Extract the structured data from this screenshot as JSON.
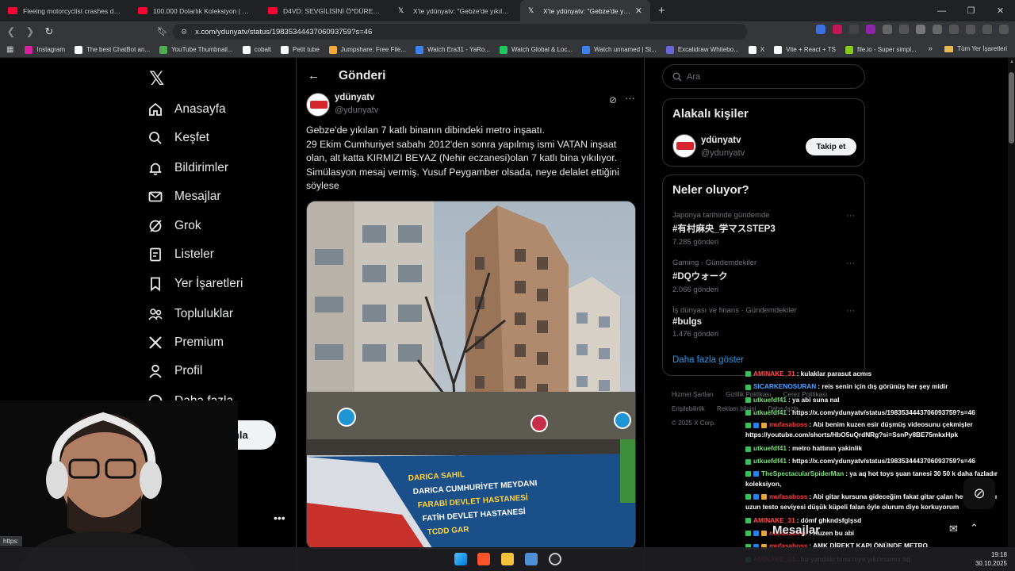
{
  "browser": {
    "tabs": [
      {
        "title": "Fleeing motorcyclist crashes during h",
        "icon_color": "#ff0033"
      },
      {
        "title": "100.000 Dolarlık Koleksiyon | Oyunc",
        "icon_color": "#ff0033"
      },
      {
        "title": "D4VD: SEVGİLİSİNİ Ö*DÜREN ŞARKI",
        "icon_color": "#ff0033"
      },
      {
        "title": "X'te ydünyatv: \"Gebze'de yıkılan 7 kat",
        "icon_color": "#ffffff"
      },
      {
        "title": "X'te ydünyatv: \"Gebze'de yıkılan",
        "icon_color": "#ffffff"
      }
    ],
    "url": "x.com/ydunyatv/status/1983534443706093759?s=46",
    "bookmarks": [
      {
        "label": "Instagram",
        "color": "#d6249f"
      },
      {
        "label": "The best ChatBot an...",
        "color": "#ffffff"
      },
      {
        "label": "YouTube Thumbnail...",
        "color": "#4caf50"
      },
      {
        "label": "cobalt",
        "color": "#ffffff"
      },
      {
        "label": "Petit tube",
        "color": "#ffffff"
      },
      {
        "label": "Jumpshare: Free File...",
        "color": "#f2a93b"
      },
      {
        "label": "Watch Era31 - YaRo...",
        "color": "#3b82f6"
      },
      {
        "label": "Watch Global & Loc...",
        "color": "#22c55e"
      },
      {
        "label": "Watch unnamed | St...",
        "color": "#3b82f6"
      },
      {
        "label": "Excalidraw Whitebo...",
        "color": "#6965db"
      },
      {
        "label": "X",
        "color": "#ffffff"
      },
      {
        "label": "Vite + React + TS",
        "color": "#ffffff"
      },
      {
        "label": "file.io - Super simpl...",
        "color": "#84cc16"
      }
    ],
    "bookmarks_folder": "Tüm Yer İşaretleri",
    "status_tip": "https:"
  },
  "nav": {
    "items": [
      {
        "label": "Anasayfa",
        "icon": "home-icon"
      },
      {
        "label": "Keşfet",
        "icon": "search-icon"
      },
      {
        "label": "Bildirimler",
        "icon": "bell-icon"
      },
      {
        "label": "Mesajlar",
        "icon": "mail-icon"
      },
      {
        "label": "Grok",
        "icon": "grok-icon"
      },
      {
        "label": "Listeler",
        "icon": "list-icon"
      },
      {
        "label": "Yer İşaretleri",
        "icon": "bookmark-icon"
      },
      {
        "label": "Topluluklar",
        "icon": "communities-icon"
      },
      {
        "label": "Premium",
        "icon": "x-icon"
      },
      {
        "label": "Profil",
        "icon": "person-icon"
      },
      {
        "label": "Daha fazla",
        "icon": "more-circle-icon"
      }
    ],
    "post_button": "Gönderi yayınla"
  },
  "post": {
    "header_title": "Gönderi",
    "author_name": "ydünyatv",
    "author_handle": "@ydunyatv",
    "text": "Gebze'de yıkılan 7 katlı binanın dibindeki metro inşaatı.\n29 Ekim Cumhuriyet sabahı 2012'den sonra yapılmış ismi VATAN inşaat olan, alt katta KIRMIZI BEYAZ (Nehir eczanesi)olan 7 katlı bina yıkılıyor. Simülasyon mesaj vermiş. Yusuf Peygamber olsada, neye delalet ettiğini söylese",
    "banner_lines": [
      "DARICA SAHIL",
      "DARICA CUMHURİYET MEYDANI",
      "FARABİ DEVLET HASTANESİ",
      "FATİH DEVLET HASTANESİ",
      "TCDD GAR"
    ]
  },
  "sidebar": {
    "search_placeholder": "Ara",
    "related_title": "Alakalı kişiler",
    "related_name": "ydünyatv",
    "related_handle": "@ydunyatv",
    "follow_label": "Takip et",
    "trends_title": "Neler oluyor?",
    "trends": [
      {
        "meta": "Japonya tarihinde gündemde",
        "tag": "#有村麻央_学マスSTEP3",
        "count": "7.285 gönderi"
      },
      {
        "meta": "Gaming · Gündemdekiler",
        "tag": "#DQウォーク",
        "count": "2.066 gönderi"
      },
      {
        "meta": "İş dünyası ve finans · Gündemdekiler",
        "tag": "#bulgs",
        "count": "1.476 gönderi"
      }
    ],
    "show_more": "Daha fazla göster",
    "footer": [
      "Hizmet Şartları",
      "Gizlilik Politikası",
      "Çerez Politikası",
      "Erişilebilirlik",
      "Reklam bilgisi",
      "Daha fazla ...",
      "© 2025 X Corp."
    ]
  },
  "messages": {
    "label": "Mesajlar"
  },
  "chat": [
    {
      "user": "AMINAKE_31",
      "color": "#ff4d4d",
      "msg": ": kulaklar parasut acmıs",
      "badges": [
        "g"
      ]
    },
    {
      "user": "SICARKENOSURAN",
      "color": "#4fa3ff",
      "msg": ": reis senin için dış görünüş her şey midir",
      "badges": [
        "g"
      ]
    },
    {
      "user": "utkuefdf41",
      "color": "#7be07b",
      "msg": ": ya abi suna nal",
      "badges": [
        "g"
      ]
    },
    {
      "user": "utkuefdf41",
      "color": "#7be07b",
      "msg": ": https://x.com/ydunyatv/status/1983534443706093759?s=46",
      "badges": [
        "g"
      ]
    },
    {
      "user": "mufasaboss",
      "color": "#ff3b3b",
      "msg": ": Abi benim kuzen esir düşmüş videosunu çekmişler https://youtube.com/shorts/HbO5uQrdNRg?si=SsnPy8BE75mkxHpk",
      "badges": [
        "g",
        "b",
        "o"
      ],
      "wrap": true
    },
    {
      "user": "utkuefdf41",
      "color": "#7be07b",
      "msg": ": metro hattının yakinlik",
      "badges": [
        "g"
      ]
    },
    {
      "user": "utkuefdf41",
      "color": "#7be07b",
      "msg": ": https://x.com/ydunyatv/status/1983534443706093759?s=46",
      "badges": [
        "g"
      ]
    },
    {
      "user": "TheSpectacularSpiderMan",
      "color": "#7be07b",
      "msg": ": ya aq hot toys şuan tanesi 30 50 k daha fazladır koleksiyon,",
      "badges": [
        "g",
        "b"
      ],
      "wrap": true
    },
    {
      "user": "mufasaboss",
      "color": "#ff3b3b",
      "msg": ": Abi gitar kursuna gideceğim fakat gitar çalan herkesin saçı uzun testo seviyesi düşük küpeli falan öyle olurum diye korkuyorum",
      "badges": [
        "g",
        "b",
        "o"
      ],
      "wrap": true
    },
    {
      "user": "AMINAKE_31",
      "color": "#ff4d4d",
      "msg": ": dömf ghkndsfglşsd",
      "badges": [
        "g"
      ]
    },
    {
      "user": "mufasaboss",
      "color": "#ff3b3b",
      "msg": ": Kuzen bu abi",
      "badges": [
        "g",
        "b",
        "o"
      ]
    },
    {
      "user": "mufasaboss",
      "color": "#ff3b3b",
      "msg": ": AMK DİREKT KAPI ÖNÜNDE METRO",
      "badges": [
        "g",
        "b",
        "o"
      ]
    },
    {
      "user": "AMINAKE_31",
      "color": "#ff4d4d",
      "msg": ": bu yandakı bına nıye yıkılmamıs aq",
      "badges": [
        "g"
      ]
    }
  ],
  "taskbar": {
    "time": "19:18",
    "date": "30.10.2025"
  }
}
